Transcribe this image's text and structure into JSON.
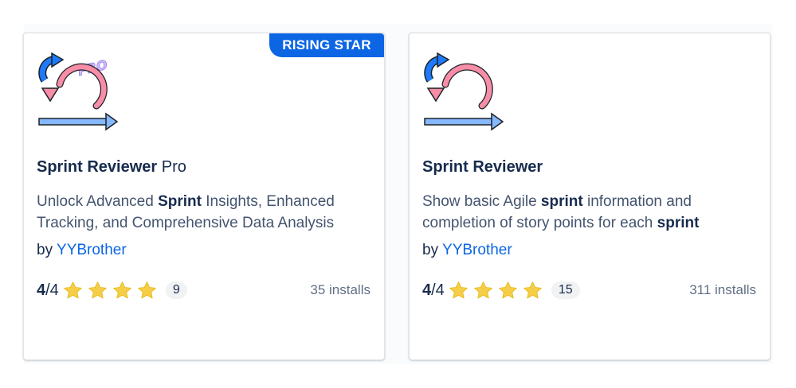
{
  "colors": {
    "accent": "#0c66e4",
    "star": "#f5cd47",
    "text": "#172b4d",
    "muted": "#626f86"
  },
  "cards": [
    {
      "badge": "RISING STAR",
      "logo": "sprint-reviewer-pro-logo",
      "logo_text": "PRO",
      "title_bold": "Sprint Reviewer",
      "title_suffix": " Pro",
      "desc": [
        "Unlock Advanced ",
        "Sprint",
        " Insights, Enhanced Tracking, and Comprehensive Data Analysis"
      ],
      "by_label": "by ",
      "vendor": "YYBrother",
      "score_value": "4",
      "score_suffix": "/4",
      "stars": 4,
      "review_count": "9",
      "installs": "35 installs"
    },
    {
      "logo": "sprint-reviewer-logo",
      "title_bold": "Sprint Reviewer",
      "title_suffix": "",
      "desc": [
        "Show basic Agile ",
        "sprint",
        " information and completion of story points for each ",
        "sprint"
      ],
      "by_label": "by ",
      "vendor": "YYBrother",
      "score_value": "4",
      "score_suffix": "/4",
      "stars": 4,
      "review_count": "15",
      "installs": "311 installs"
    }
  ]
}
